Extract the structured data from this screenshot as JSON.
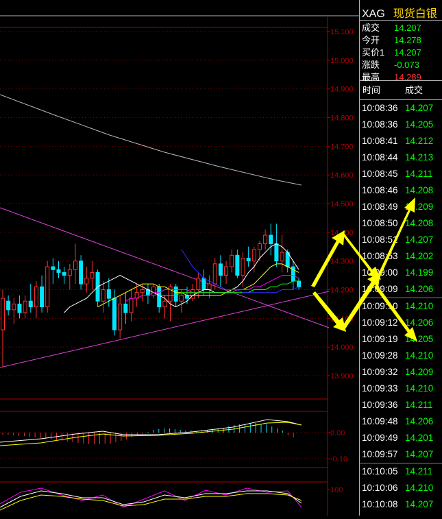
{
  "symbol": "XAG",
  "instrument_name": "现货白银",
  "colors": {
    "up": "#00ff00",
    "down": "#ff3030",
    "neutral": "#ffffff",
    "axis": "#b00000",
    "label": "#ffd700"
  },
  "quote": [
    {
      "label": "成交",
      "value": "14.207",
      "color": "#00ff00"
    },
    {
      "label": "今开",
      "value": "14.278",
      "color": "#00ff00"
    },
    {
      "label": "买价1",
      "value": "14.207",
      "color": "#00ff00"
    },
    {
      "label": "涨跌",
      "value": "-0.073",
      "color": "#00ff00"
    },
    {
      "label": "最高",
      "value": "14.289",
      "color": "#ff3030"
    }
  ],
  "ticks_header": {
    "time": "时间",
    "price": "成交"
  },
  "ticks": [
    {
      "time": "10:08:36",
      "price": "14.207"
    },
    {
      "time": "10:08:36",
      "price": "14.205"
    },
    {
      "time": "10:08:41",
      "price": "14.212"
    },
    {
      "time": "10:08:44",
      "price": "14.213"
    },
    {
      "time": "10:08:45",
      "price": "14.211"
    },
    {
      "time": "10:08:46",
      "price": "14.208"
    },
    {
      "time": "10:08:49",
      "price": "14.209"
    },
    {
      "time": "10:08:50",
      "price": "14.208"
    },
    {
      "time": "10:08:51",
      "price": "14.207"
    },
    {
      "time": "10:08:53",
      "price": "14.202"
    },
    {
      "time": "10:09:00",
      "price": "14.199"
    },
    {
      "time": "10:09:09",
      "price": "14.206"
    },
    {
      "time": "10:09:10",
      "price": "14.210"
    },
    {
      "time": "10:09:12",
      "price": "14.206"
    },
    {
      "time": "10:09:19",
      "price": "14.205"
    },
    {
      "time": "10:09:28",
      "price": "14.210"
    },
    {
      "time": "10:09:32",
      "price": "14.209"
    },
    {
      "time": "10:09:33",
      "price": "14.210"
    },
    {
      "time": "10:09:36",
      "price": "14.211"
    },
    {
      "time": "10:09:48",
      "price": "14.206"
    },
    {
      "time": "10:09:49",
      "price": "14.201"
    },
    {
      "time": "10:09:57",
      "price": "14.207"
    },
    {
      "time": "10:10:05",
      "price": "14.211"
    },
    {
      "time": "10:10:06",
      "price": "14.210"
    },
    {
      "time": "10:10:08",
      "price": "14.207"
    }
  ],
  "chart_data": [
    {
      "type": "candlestick",
      "y_axis_labels": [
        "15.100",
        "15.000",
        "14.900",
        "14.800",
        "14.700",
        "14.600",
        "14.500",
        "14.400",
        "14.300",
        "14.200",
        "14.100",
        "14.000",
        "13.900"
      ],
      "ylim": [
        13.86,
        15.11
      ],
      "grid": true,
      "candles": [
        {
          "o": 14.06,
          "h": 14.2,
          "l": 13.93,
          "c": 14.17
        },
        {
          "o": 14.16,
          "h": 14.18,
          "l": 14.11,
          "c": 14.13
        },
        {
          "o": 14.13,
          "h": 14.17,
          "l": 14.08,
          "c": 14.15
        },
        {
          "o": 14.15,
          "h": 14.18,
          "l": 14.1,
          "c": 14.12
        },
        {
          "o": 14.12,
          "h": 14.18,
          "l": 14.1,
          "c": 14.16
        },
        {
          "o": 14.16,
          "h": 14.22,
          "l": 14.12,
          "c": 14.14
        },
        {
          "o": 14.14,
          "h": 14.23,
          "l": 14.1,
          "c": 14.21
        },
        {
          "o": 14.21,
          "h": 14.25,
          "l": 14.12,
          "c": 14.14
        },
        {
          "o": 14.14,
          "h": 14.3,
          "l": 14.12,
          "c": 14.28
        },
        {
          "o": 14.28,
          "h": 14.31,
          "l": 14.22,
          "c": 14.27
        },
        {
          "o": 14.27,
          "h": 14.3,
          "l": 14.24,
          "c": 14.26
        },
        {
          "o": 14.26,
          "h": 14.28,
          "l": 14.22,
          "c": 14.25
        },
        {
          "o": 14.25,
          "h": 14.29,
          "l": 14.2,
          "c": 14.27
        },
        {
          "o": 14.27,
          "h": 14.36,
          "l": 14.22,
          "c": 14.3
        },
        {
          "o": 14.3,
          "h": 14.32,
          "l": 14.2,
          "c": 14.22
        },
        {
          "o": 14.22,
          "h": 14.28,
          "l": 14.19,
          "c": 14.24
        },
        {
          "o": 14.24,
          "h": 14.3,
          "l": 14.2,
          "c": 14.26
        },
        {
          "o": 14.26,
          "h": 14.27,
          "l": 14.14,
          "c": 14.16
        },
        {
          "o": 14.16,
          "h": 14.23,
          "l": 14.12,
          "c": 14.2
        },
        {
          "o": 14.2,
          "h": 14.24,
          "l": 14.14,
          "c": 14.17
        },
        {
          "o": 14.17,
          "h": 14.2,
          "l": 14.04,
          "c": 14.06
        },
        {
          "o": 14.06,
          "h": 14.18,
          "l": 14.03,
          "c": 14.15
        },
        {
          "o": 14.15,
          "h": 14.19,
          "l": 14.08,
          "c": 14.12
        },
        {
          "o": 14.12,
          "h": 14.2,
          "l": 14.09,
          "c": 14.17
        },
        {
          "o": 14.17,
          "h": 14.22,
          "l": 14.14,
          "c": 14.19
        },
        {
          "o": 14.19,
          "h": 14.22,
          "l": 14.16,
          "c": 14.2
        },
        {
          "o": 14.2,
          "h": 14.22,
          "l": 14.15,
          "c": 14.18
        },
        {
          "o": 14.18,
          "h": 14.22,
          "l": 14.17,
          "c": 14.21
        },
        {
          "o": 14.21,
          "h": 14.22,
          "l": 14.12,
          "c": 14.14
        },
        {
          "o": 14.14,
          "h": 14.18,
          "l": 14.1,
          "c": 14.16
        },
        {
          "o": 14.16,
          "h": 14.22,
          "l": 14.09,
          "c": 14.21
        },
        {
          "o": 14.21,
          "h": 14.22,
          "l": 14.14,
          "c": 14.16
        },
        {
          "o": 14.16,
          "h": 14.2,
          "l": 14.12,
          "c": 14.18
        },
        {
          "o": 14.18,
          "h": 14.21,
          "l": 14.15,
          "c": 14.17
        },
        {
          "o": 14.17,
          "h": 14.22,
          "l": 14.16,
          "c": 14.2
        },
        {
          "o": 14.2,
          "h": 14.26,
          "l": 14.17,
          "c": 14.24
        },
        {
          "o": 14.24,
          "h": 14.27,
          "l": 14.18,
          "c": 14.2
        },
        {
          "o": 14.2,
          "h": 14.25,
          "l": 14.17,
          "c": 14.22
        },
        {
          "o": 14.22,
          "h": 14.31,
          "l": 14.2,
          "c": 14.29
        },
        {
          "o": 14.29,
          "h": 14.32,
          "l": 14.21,
          "c": 14.25
        },
        {
          "o": 14.25,
          "h": 14.3,
          "l": 14.22,
          "c": 14.28
        },
        {
          "o": 14.28,
          "h": 14.34,
          "l": 14.26,
          "c": 14.32
        },
        {
          "o": 14.32,
          "h": 14.34,
          "l": 14.24,
          "c": 14.25
        },
        {
          "o": 14.25,
          "h": 14.33,
          "l": 14.21,
          "c": 14.31
        },
        {
          "o": 14.31,
          "h": 14.35,
          "l": 14.28,
          "c": 14.3
        },
        {
          "o": 14.3,
          "h": 14.35,
          "l": 14.26,
          "c": 14.34
        },
        {
          "o": 14.34,
          "h": 14.37,
          "l": 14.3,
          "c": 14.36
        },
        {
          "o": 14.36,
          "h": 14.41,
          "l": 14.34,
          "c": 14.39
        },
        {
          "o": 14.39,
          "h": 14.43,
          "l": 14.32,
          "c": 14.36
        },
        {
          "o": 14.36,
          "h": 14.43,
          "l": 14.28,
          "c": 14.3
        },
        {
          "o": 14.3,
          "h": 14.39,
          "l": 14.26,
          "c": 14.33
        },
        {
          "o": 14.33,
          "h": 14.34,
          "l": 14.26,
          "c": 14.28
        },
        {
          "o": 14.28,
          "h": 14.3,
          "l": 14.2,
          "c": 14.23
        },
        {
          "o": 14.23,
          "h": 14.24,
          "l": 14.2,
          "c": 14.21
        }
      ],
      "moving_averages": [
        {
          "color": "#ffffff",
          "values": [
            14.12,
            14.14,
            14.15,
            14.16,
            14.17,
            14.19,
            14.21,
            14.22,
            14.23,
            14.24,
            14.25,
            14.24,
            14.23,
            14.22,
            14.21,
            14.2,
            14.19,
            14.18,
            14.17,
            14.15,
            14.14,
            14.15,
            14.16,
            14.18,
            14.19,
            14.2,
            14.2,
            14.19,
            14.19,
            14.19,
            14.2,
            14.21,
            14.23,
            14.26,
            14.28,
            14.31,
            14.33,
            14.35,
            14.36,
            14.35,
            14.33,
            14.3,
            14.27
          ]
        },
        {
          "color": "#ffff00",
          "values": [
            14.14,
            14.15,
            14.16,
            14.17,
            14.18,
            14.19,
            14.2,
            14.21,
            14.22,
            14.22,
            14.22,
            14.21,
            14.21,
            14.2,
            14.19,
            14.19,
            14.18,
            14.18,
            14.18,
            14.18,
            14.18,
            14.18,
            14.18,
            14.19,
            14.19,
            14.2,
            14.2,
            14.21,
            14.22,
            14.24,
            14.26,
            14.28,
            14.29,
            14.29,
            14.28,
            14.27,
            14.26
          ]
        },
        {
          "color": "#ff00ff",
          "values": [
            14.16,
            14.17,
            14.17,
            14.18,
            14.18,
            14.19,
            14.19,
            14.2,
            14.2,
            14.2,
            14.2,
            14.2,
            14.19,
            14.19,
            14.19,
            14.19,
            14.19,
            14.19,
            14.19,
            14.19,
            14.2,
            14.2,
            14.2,
            14.21,
            14.21,
            14.22,
            14.23,
            14.24,
            14.25,
            14.25,
            14.25,
            14.24
          ]
        },
        {
          "color": "#00ff00",
          "values": [
            14.18,
            14.18,
            14.18,
            14.18,
            14.19,
            14.19,
            14.19,
            14.19,
            14.19,
            14.19,
            14.19,
            14.19,
            14.19,
            14.19,
            14.19,
            14.19,
            14.19,
            14.2,
            14.2,
            14.2,
            14.21,
            14.21,
            14.22,
            14.22,
            14.23,
            14.23
          ]
        },
        {
          "color": "#3030ff",
          "values": [
            14.34,
            14.31,
            14.28,
            14.26,
            14.24,
            14.23,
            14.22,
            14.21,
            14.2,
            14.2,
            14.2,
            14.19,
            14.19,
            14.19,
            14.19,
            14.19,
            14.19,
            14.19,
            14.2,
            14.2,
            14.2,
            14.21
          ]
        }
      ]
    },
    {
      "type": "bar",
      "y_axis_labels": [
        "0.00",
        "-0.10"
      ]
    },
    {
      "type": "line",
      "y_axis_labels": [
        "100"
      ]
    }
  ]
}
